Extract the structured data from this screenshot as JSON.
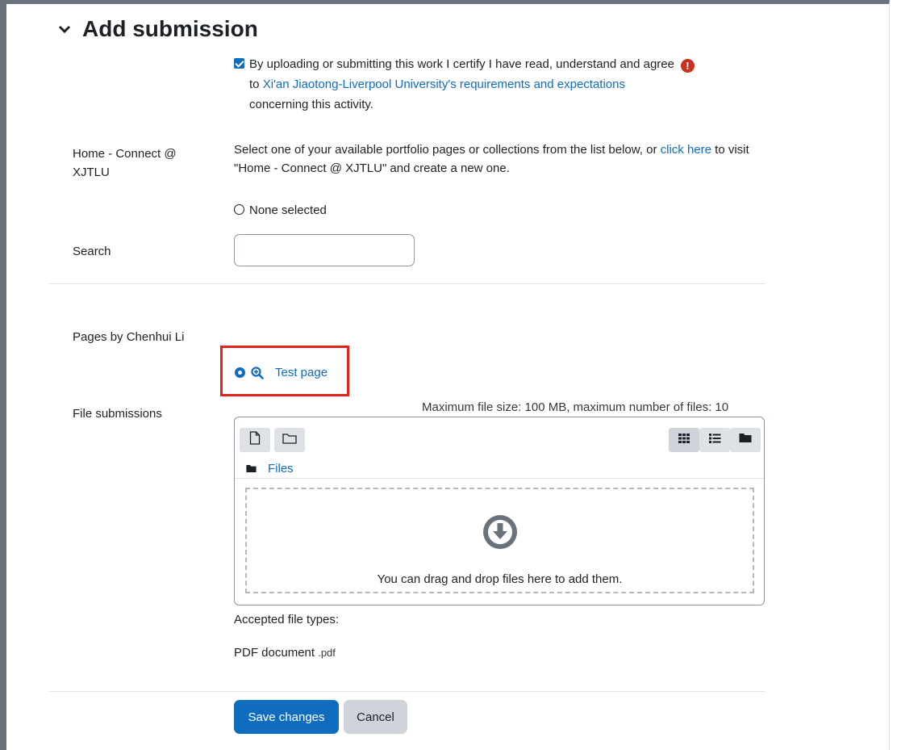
{
  "section": {
    "title": "Add submission"
  },
  "statement": {
    "text_before": "By uploading or submitting this work I certify I have read, understand and agree",
    "text_to": "to ",
    "link": "Xi'an Jiaotong-Liverpool University's requirements and expectations",
    "text_after": "concerning this activity.",
    "checked": true
  },
  "portfolio": {
    "label_line1": "Home - Connect @",
    "label_line2": "XJTLU",
    "desc_before": "Select one of your available portfolio pages or collections from the list below, or ",
    "desc_link": "click here",
    "desc_after": " to visit \"Home - Connect @ XJTLU\" and create a new one.",
    "none_option": "None selected"
  },
  "search": {
    "label": "Search",
    "value": ""
  },
  "pages": {
    "label": "Pages by Chenhui Li",
    "selected_item": "Test page"
  },
  "file_submissions": {
    "label": "File submissions",
    "limits": "Maximum file size: 100 MB, maximum number of files: 10",
    "breadcrumb": "Files",
    "drop_text": "You can drag and drop files here to add them.",
    "accepted_label": "Accepted file types:",
    "accepted_type": "PDF document",
    "accepted_ext": ".pdf"
  },
  "buttons": {
    "save": "Save changes",
    "cancel": "Cancel"
  },
  "colors": {
    "link": "#0f6cbf",
    "primary": "#0f6cbf",
    "highlight": "#e1251b",
    "warning": "#ca3120"
  }
}
